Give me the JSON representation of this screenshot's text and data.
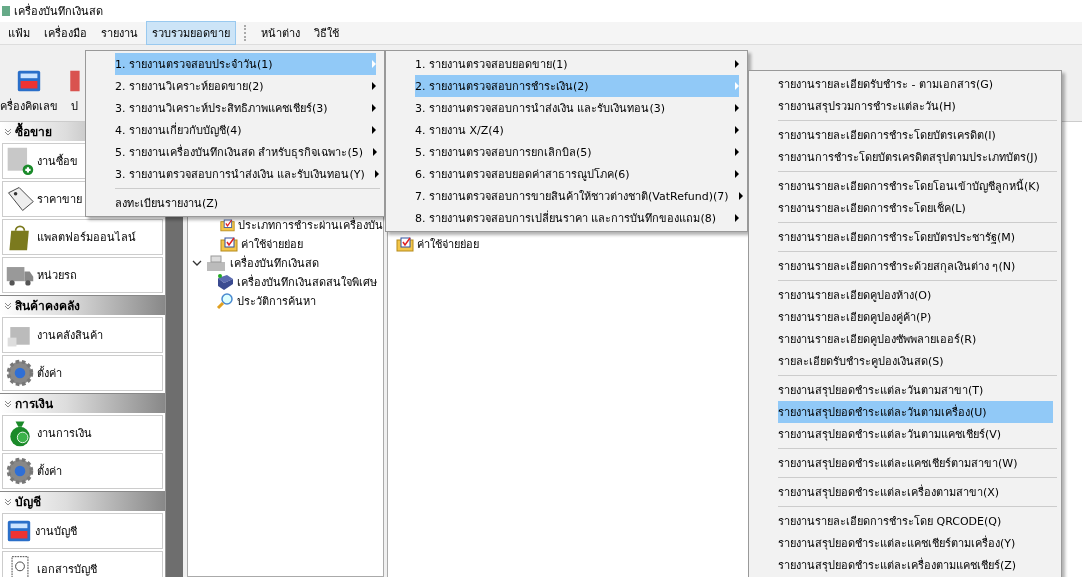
{
  "window": {
    "title": "เครื่องบันทึกเงินสด"
  },
  "menu_bar": [
    {
      "label": "แฟ้ม",
      "selected": false
    },
    {
      "label": "เครื่องมือ",
      "selected": false
    },
    {
      "label": "รายงาน",
      "selected": false
    },
    {
      "label": "รวบรวมยอดขาย",
      "selected": true
    },
    {
      "label": "หน้าต่าง",
      "selected": false
    },
    {
      "label": "วิธีใช้",
      "selected": false
    }
  ],
  "toolbar": [
    {
      "label": "ครื่องคิดเลข",
      "kind": "calculator"
    },
    {
      "label": "ป",
      "kind": "red"
    }
  ],
  "sidebar": [
    {
      "title": "ซื้อขาย",
      "items": [
        {
          "label": "งานซื้อข",
          "kind": "sale"
        },
        {
          "label": "ราคาขาย",
          "kind": "tag"
        },
        {
          "label": "แพลตฟอร์มออนไลน์",
          "kind": "bag"
        },
        {
          "label": "หน่วยรถ",
          "kind": "truck"
        }
      ]
    },
    {
      "title": "สินค้าคงคลัง",
      "items": [
        {
          "label": "งานคลังสินค้า",
          "kind": "box"
        },
        {
          "label": "ตั้งค่า",
          "kind": "gear"
        }
      ]
    },
    {
      "title": "การเงิน",
      "items": [
        {
          "label": "งานการเงิน",
          "kind": "money"
        },
        {
          "label": "ตั้งค่า",
          "kind": "gear"
        }
      ]
    },
    {
      "title": "บัญชี",
      "items": [
        {
          "label": "งานบัญชี",
          "kind": "calculator"
        },
        {
          "label": "เอกสารบัญชี",
          "kind": "document"
        }
      ]
    }
  ],
  "tree": {
    "items_above": [
      {
        "label": "ประเภทการชำระผ่านเครื่องบัน",
        "kind": "checklist"
      },
      {
        "label": "ค่าใช้จ่ายย่อย",
        "kind": "checklist"
      }
    ],
    "nodes": [
      {
        "label": "เครื่องบันทึกเงินสด",
        "kind": "register",
        "expanded": true,
        "children": [
          {
            "label": "เครื่องบันทึกเงินสดสนใจพิเศษ",
            "kind": "book"
          },
          {
            "label": "ประวัติการค้นหา",
            "kind": "search"
          }
        ]
      }
    ]
  },
  "content_panel": {
    "items": [
      {
        "label": "ค่าใช้จ่ายย่อย",
        "kind": "checklist"
      }
    ]
  },
  "menus": [
    {
      "items": [
        {
          "label": "1. รายงานตรวจสอบประจำวัน(1)",
          "selected": true,
          "submenu": true,
          "separator_before": false
        },
        {
          "label": "2. รายงานวิเคราะห์ยอดขาย(2)",
          "selected": false,
          "submenu": true,
          "separator_before": false
        },
        {
          "label": "3. รายงานวิเคราะห์ประสิทธิภาพแคชเชียร์(3)",
          "selected": false,
          "submenu": true,
          "separator_before": false
        },
        {
          "label": "4. รายงานเกี่ยวกับบัญชี(4)",
          "selected": false,
          "submenu": true,
          "separator_before": false
        },
        {
          "label": "5. รายงานเครื่องบันทึกเงินสด สำหรับธุรกิจเฉพาะ(5)",
          "selected": false,
          "submenu": true,
          "separator_before": false
        },
        {
          "label": "3. รายงานตรวจสอบการนำส่งเงิน และรับเงินทอน(Y)",
          "selected": false,
          "submenu": true,
          "separator_before": false
        },
        {
          "label": "ลงทะเบียนรายงาน(Z)",
          "selected": false,
          "submenu": false,
          "separator_before": true
        }
      ]
    },
    {
      "items": [
        {
          "label": "1. รายงานตรวจสอบยอดขาย(1)",
          "selected": false,
          "submenu": true,
          "separator_before": false
        },
        {
          "label": "2. รายงานตรวจสอบการชำระเงิน(2)",
          "selected": true,
          "submenu": true,
          "separator_before": false
        },
        {
          "label": "3. รายงานตรวจสอบการนำส่งเงิน และรับเงินทอน(3)",
          "selected": false,
          "submenu": true,
          "separator_before": false
        },
        {
          "label": "4. รายงาน X/Z(4)",
          "selected": false,
          "submenu": true,
          "separator_before": false
        },
        {
          "label": "5. รายงานตรวจสอบการยกเลิกบิล(5)",
          "selected": false,
          "submenu": true,
          "separator_before": false
        },
        {
          "label": "6. รายงานตรวจสอบยอดค่าสาธารณูปโภค(6)",
          "selected": false,
          "submenu": true,
          "separator_before": false
        },
        {
          "label": "7. รายงานตรวจสอบการขายสินค้าให้ชาวต่างชาติ(VatRefund)(7)",
          "selected": false,
          "submenu": true,
          "separator_before": false
        },
        {
          "label": "8. รายงานตรวจสอบการเปลี่ยนราคา และการบันทึกของแถม(8)",
          "selected": false,
          "submenu": true,
          "separator_before": false
        }
      ]
    },
    {
      "items": [
        {
          "label": "รายงานรายละเอียดรับชำระ - ตามเอกสาร(G)",
          "selected": false,
          "submenu": false,
          "separator_before": false
        },
        {
          "label": "รายงานสรุปรวมการชำระแต่ละวัน(H)",
          "selected": false,
          "submenu": false,
          "separator_before": false
        },
        {
          "label": "รายงานรายละเอียดการชำระโดยบัตรเครดิต(I)",
          "selected": false,
          "submenu": false,
          "separator_before": true
        },
        {
          "label": "รายงานการชำระโดยบัตรเครดิตสรุปตามประเภทบัตร(J)",
          "selected": false,
          "submenu": false,
          "separator_before": false
        },
        {
          "label": "รายงานรายละเอียดการชำระโดยโอนเข้าบัญชีลูกหนี้(K)",
          "selected": false,
          "submenu": false,
          "separator_before": true
        },
        {
          "label": "รายงานรายละเอียดการชำระโดยเช็ค(L)",
          "selected": false,
          "submenu": false,
          "separator_before": false
        },
        {
          "label": "รายงานรายละเอียดการชำระโดยบัตรประชารัฐ(M)",
          "selected": false,
          "submenu": false,
          "separator_before": true
        },
        {
          "label": "รายงานรายละเอียดการชำระด้วยสกุลเงินต่าง ๆ(N)",
          "selected": false,
          "submenu": false,
          "separator_before": true
        },
        {
          "label": "รายงานรายละเอียดคูปองห้าง(O)",
          "selected": false,
          "submenu": false,
          "separator_before": true
        },
        {
          "label": "รายงานรายละเอียดคูปองคู่ค้า(P)",
          "selected": false,
          "submenu": false,
          "separator_before": false
        },
        {
          "label": "รายงานรายละเอียดคูปองซัพพลายเออร์(R)",
          "selected": false,
          "submenu": false,
          "separator_before": false
        },
        {
          "label": "รายละเอียดรับชำระคูปองเงินสด(S)",
          "selected": false,
          "submenu": false,
          "separator_before": false
        },
        {
          "label": "รายงานสรุปยอดชำระแต่ละวันตามสาขา(T)",
          "selected": false,
          "submenu": false,
          "separator_before": true
        },
        {
          "label": "รายงานสรุปยอดชำระแต่ละวันตามเครื่อง(U)",
          "selected": true,
          "submenu": false,
          "separator_before": false
        },
        {
          "label": "รายงานสรุปยอดชำระแต่ละวันตามแคชเชียร์(V)",
          "selected": false,
          "submenu": false,
          "separator_before": false
        },
        {
          "label": "รายงานสรุปยอดชำระแต่ละแคชเชียร์ตามสาขา(W)",
          "selected": false,
          "submenu": false,
          "separator_before": true
        },
        {
          "label": "รายงานสรุปยอดชำระแต่ละเครื่องตามสาขา(X)",
          "selected": false,
          "submenu": false,
          "separator_before": true
        },
        {
          "label": "รายงานรายละเอียดการชำระโดย QRCODE(Q)",
          "selected": false,
          "submenu": false,
          "separator_before": true
        },
        {
          "label": "รายงานสรุปยอดชำระแต่ละแคชเชียร์ตามเครื่อง(Y)",
          "selected": false,
          "submenu": false,
          "separator_before": false
        },
        {
          "label": "รายงานสรุปยอดชำระแต่ละเครื่องตามแคชเชียร์(Z)",
          "selected": false,
          "submenu": false,
          "separator_before": false
        }
      ]
    }
  ]
}
